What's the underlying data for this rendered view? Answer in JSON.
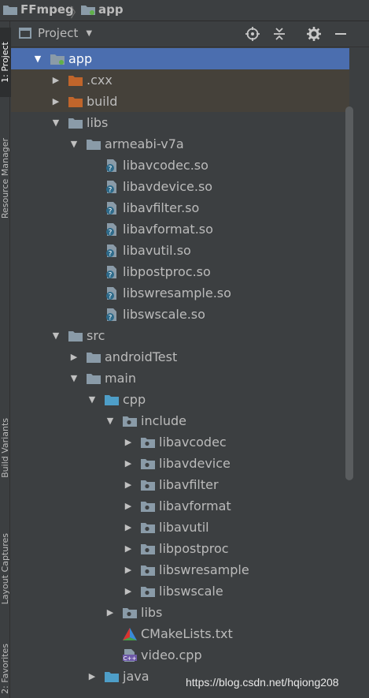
{
  "breadcrumb": {
    "project": "FFmpeg",
    "module": "app"
  },
  "tool_strip": {
    "tabs": [
      {
        "label": "1: Project"
      },
      {
        "label": "Resource Manager"
      },
      {
        "label": "Build Variants"
      },
      {
        "label": "Layout Captures"
      },
      {
        "label": "2: Favorites"
      }
    ]
  },
  "panel": {
    "view_selector": "Project",
    "icons": [
      "locate-icon",
      "collapse-all-icon",
      "settings-gear-icon",
      "hide-minimize-icon"
    ]
  },
  "tree": [
    {
      "label": "app",
      "depth": 0,
      "state": "expanded",
      "icon": "module-folder-icon",
      "selected": true
    },
    {
      "label": ".cxx",
      "depth": 1,
      "state": "collapsed",
      "icon": "excluded-folder-icon",
      "excluded": true
    },
    {
      "label": "build",
      "depth": 1,
      "state": "collapsed",
      "icon": "excluded-folder-icon",
      "excluded": true
    },
    {
      "label": "libs",
      "depth": 1,
      "state": "expanded",
      "icon": "folder-icon"
    },
    {
      "label": "armeabi-v7a",
      "depth": 2,
      "state": "expanded",
      "icon": "folder-icon"
    },
    {
      "label": "libavcodec.so",
      "depth": 3,
      "state": "leaf",
      "icon": "unknown-file-icon"
    },
    {
      "label": "libavdevice.so",
      "depth": 3,
      "state": "leaf",
      "icon": "unknown-file-icon"
    },
    {
      "label": "libavfilter.so",
      "depth": 3,
      "state": "leaf",
      "icon": "unknown-file-icon"
    },
    {
      "label": "libavformat.so",
      "depth": 3,
      "state": "leaf",
      "icon": "unknown-file-icon"
    },
    {
      "label": "libavutil.so",
      "depth": 3,
      "state": "leaf",
      "icon": "unknown-file-icon"
    },
    {
      "label": "libpostproc.so",
      "depth": 3,
      "state": "leaf",
      "icon": "unknown-file-icon"
    },
    {
      "label": "libswresample.so",
      "depth": 3,
      "state": "leaf",
      "icon": "unknown-file-icon"
    },
    {
      "label": "libswscale.so",
      "depth": 3,
      "state": "leaf",
      "icon": "unknown-file-icon"
    },
    {
      "label": "src",
      "depth": 1,
      "state": "expanded",
      "icon": "folder-icon"
    },
    {
      "label": "androidTest",
      "depth": 2,
      "state": "collapsed",
      "icon": "folder-icon"
    },
    {
      "label": "main",
      "depth": 2,
      "state": "expanded",
      "icon": "folder-icon"
    },
    {
      "label": "cpp",
      "depth": 3,
      "state": "expanded",
      "icon": "source-folder-icon"
    },
    {
      "label": "include",
      "depth": 4,
      "state": "expanded",
      "icon": "package-folder-icon"
    },
    {
      "label": "libavcodec",
      "depth": 5,
      "state": "collapsed",
      "icon": "package-folder-icon"
    },
    {
      "label": "libavdevice",
      "depth": 5,
      "state": "collapsed",
      "icon": "package-folder-icon"
    },
    {
      "label": "libavfilter",
      "depth": 5,
      "state": "collapsed",
      "icon": "package-folder-icon"
    },
    {
      "label": "libavformat",
      "depth": 5,
      "state": "collapsed",
      "icon": "package-folder-icon"
    },
    {
      "label": "libavutil",
      "depth": 5,
      "state": "collapsed",
      "icon": "package-folder-icon"
    },
    {
      "label": "libpostproc",
      "depth": 5,
      "state": "collapsed",
      "icon": "package-folder-icon"
    },
    {
      "label": "libswresample",
      "depth": 5,
      "state": "collapsed",
      "icon": "package-folder-icon"
    },
    {
      "label": "libswscale",
      "depth": 5,
      "state": "collapsed",
      "icon": "package-folder-icon"
    },
    {
      "label": "libs",
      "depth": 4,
      "state": "collapsed",
      "icon": "package-folder-icon"
    },
    {
      "label": "CMakeLists.txt",
      "depth": 4,
      "state": "leaf",
      "icon": "cmake-icon"
    },
    {
      "label": "video.cpp",
      "depth": 4,
      "state": "leaf",
      "icon": "cpp-file-icon"
    },
    {
      "label": "java",
      "depth": 3,
      "state": "collapsed",
      "icon": "source-folder-icon"
    }
  ],
  "watermark": "https://blog.csdn.net/hqiong208",
  "colors": {
    "background": "#3c3f41",
    "selection": "#4b6eaf",
    "excluded_row": "#45413a",
    "folder": "#8a9ba8",
    "excluded_folder": "#c0652b",
    "source_folder": "#4e9ec8"
  }
}
